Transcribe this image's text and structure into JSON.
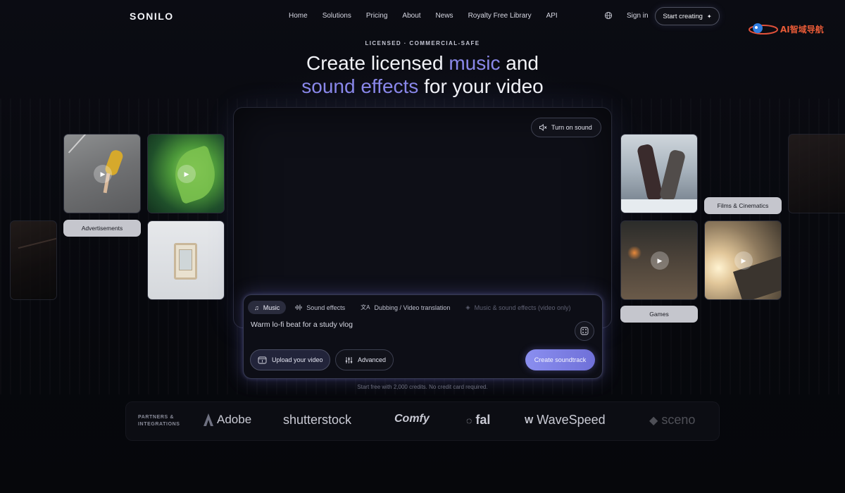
{
  "brand": {
    "logo_text": "SONILO"
  },
  "nav": {
    "items": [
      "Home",
      "Solutions",
      "Pricing",
      "About",
      "News",
      "Royalty Free Library",
      "API"
    ],
    "globe_icon": "globe-icon",
    "signin_label": "Sign in",
    "start_label": "Start creating",
    "start_icon": "sparkle-icon"
  },
  "watermark": {
    "text": "AI智域导航"
  },
  "hero": {
    "eyebrow": "LICENSED · COMMERCIAL-SAFE",
    "line1_plain": "Create licensed ",
    "line1_accent": "music",
    "line1_tail": " and",
    "line2_accent": "sound effects",
    "line2_tail": " for your video",
    "accent_color": "#8a88ea"
  },
  "video": {
    "sound_button_label": "Turn on sound",
    "sound_icon": "speaker-muted-icon"
  },
  "prompt": {
    "tabs": [
      {
        "label": "Music",
        "icon": "music-note-icon",
        "active": true
      },
      {
        "label": "Sound effects",
        "icon": "waveform-icon",
        "active": false
      },
      {
        "label": "Dubbing / Video translation",
        "icon": "translate-icon",
        "active": false
      },
      {
        "label": "Music & sound effects (video only)",
        "icon": "layers-icon",
        "active": false,
        "disabled": true
      }
    ],
    "value": "Warm lo-fi beat for a study vlog",
    "dice_icon": "dice-icon",
    "upload_label": "Upload your video",
    "advanced_label": "Advanced",
    "create_label": "Create soundtrack"
  },
  "footnote": "Start free with 2,000 credits. No credit card required.",
  "categories": {
    "advertisements": "Advertisements",
    "films": "Films & Cinematics",
    "games": "Games"
  },
  "partners": {
    "label_line1": "PARTNERS &",
    "label_line2": "INTEGRATIONS",
    "logos": [
      "Adobe",
      "shutterstock",
      "Comfy",
      "fal",
      "WaveSpeed",
      "sceno"
    ]
  }
}
